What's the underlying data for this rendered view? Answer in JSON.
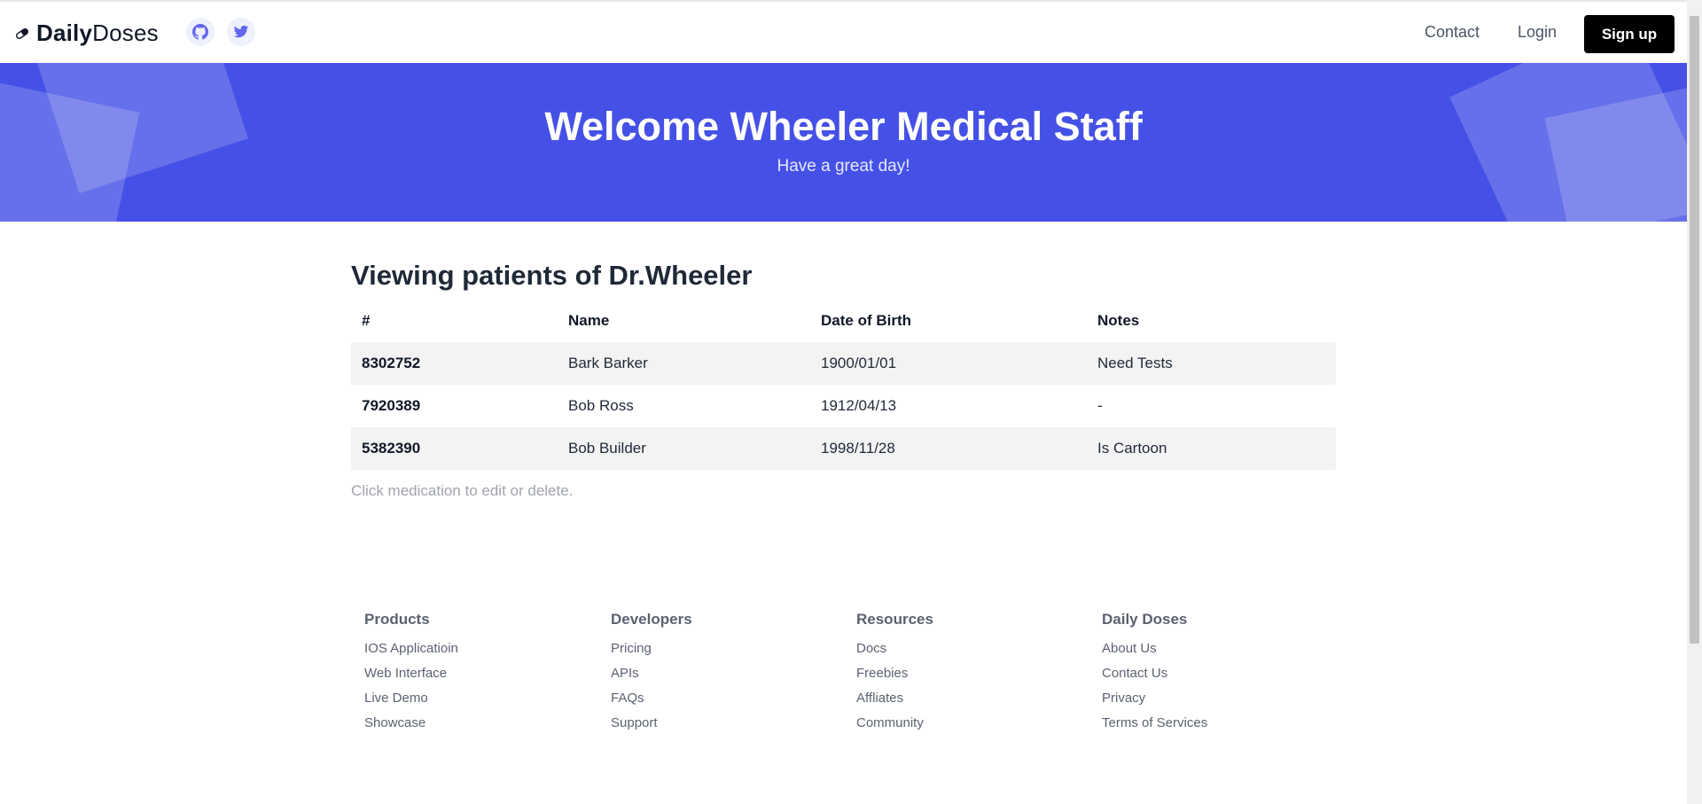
{
  "header": {
    "brand_bold": "Daily",
    "brand_light": "Doses",
    "nav": {
      "contact": "Contact",
      "login": "Login",
      "signup": "Sign up"
    }
  },
  "hero": {
    "title": "Welcome Wheeler Medical Staff",
    "subtitle": "Have a great day!"
  },
  "main": {
    "title": "Viewing patients of Dr.Wheeler",
    "columns": [
      "#",
      "Name",
      "Date of Birth",
      "Notes"
    ],
    "rows": [
      {
        "id": "8302752",
        "name": "Bark Barker",
        "dob": "1900/01/01",
        "notes": "Need Tests"
      },
      {
        "id": "7920389",
        "name": "Bob Ross",
        "dob": "1912/04/13",
        "notes": "-"
      },
      {
        "id": "5382390",
        "name": "Bob Builder",
        "dob": "1998/11/28",
        "notes": "Is Cartoon"
      }
    ],
    "hint": "Click medication to edit or delete."
  },
  "footer": {
    "columns": [
      {
        "title": "Products",
        "links": [
          "IOS Applicatioin",
          "Web Interface",
          "Live Demo",
          "Showcase"
        ]
      },
      {
        "title": "Developers",
        "links": [
          "Pricing",
          "APIs",
          "FAQs",
          "Support"
        ]
      },
      {
        "title": "Resources",
        "links": [
          "Docs",
          "Freebies",
          "Affliates",
          "Community"
        ]
      },
      {
        "title": "Daily Doses",
        "links": [
          "About Us",
          "Contact Us",
          "Privacy",
          "Terms of Services"
        ]
      }
    ]
  },
  "colors": {
    "hero": "#4551e6",
    "signup": "#000000",
    "accent_icon": "#6366f1"
  },
  "icons": [
    "pill-icon",
    "github-icon",
    "twitter-icon"
  ]
}
